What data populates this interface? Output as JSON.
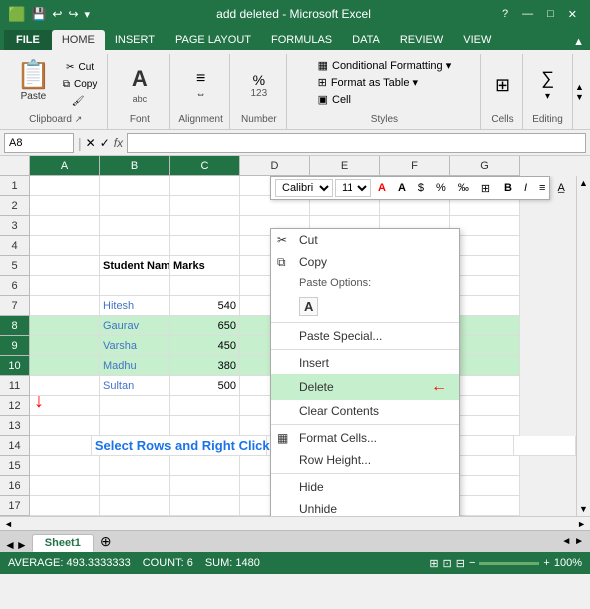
{
  "titleBar": {
    "title": "add deleted - Microsoft Excel",
    "controls": [
      "?",
      "—",
      "□",
      "✕"
    ]
  },
  "ribbonTabs": [
    "FILE",
    "HOME",
    "INSERT",
    "PAGE LAYOUT",
    "FORMULAS",
    "DATA",
    "REVIEW",
    "VIEW"
  ],
  "activeTab": "HOME",
  "ribbon": {
    "clipboard": {
      "label": "Clipboard",
      "paste": "Paste"
    },
    "font": {
      "label": "Font"
    },
    "alignment": {
      "label": "Alignment"
    },
    "number": {
      "label": "Number"
    },
    "conditionalFormatting": "Conditional Formatting ▾",
    "formatAsTable": "Format as Table ▾",
    "cellStyle": "Cell",
    "cells": {
      "label": "Cells"
    },
    "editing": {
      "label": "Editing"
    }
  },
  "formulaBar": {
    "nameBox": "A8",
    "fx": "fx"
  },
  "columns": [
    "A",
    "B",
    "C",
    "D",
    "E",
    "F",
    "G"
  ],
  "rows": [
    {
      "num": 1,
      "cells": [
        "",
        "",
        "",
        "",
        "",
        "",
        ""
      ]
    },
    {
      "num": 2,
      "cells": [
        "",
        "",
        "",
        "",
        "",
        "",
        ""
      ]
    },
    {
      "num": 3,
      "cells": [
        "",
        "",
        "",
        "",
        "",
        "",
        ""
      ]
    },
    {
      "num": 4,
      "cells": [
        "",
        "",
        "",
        "",
        "",
        "",
        ""
      ]
    },
    {
      "num": 5,
      "cells": [
        "",
        "Student Name",
        "Marks",
        "",
        "",
        "",
        ""
      ]
    },
    {
      "num": 6,
      "cells": [
        "",
        "",
        "",
        "",
        "",
        "",
        ""
      ]
    },
    {
      "num": 7,
      "cells": [
        "",
        "Hitesh",
        "540",
        "",
        "",
        "",
        ""
      ]
    },
    {
      "num": 8,
      "cells": [
        "",
        "Gaurav",
        "650",
        "",
        "",
        "",
        ""
      ],
      "selected": true
    },
    {
      "num": 9,
      "cells": [
        "",
        "Varsha",
        "450",
        "",
        "",
        "",
        ""
      ],
      "selected": true
    },
    {
      "num": 10,
      "cells": [
        "",
        "Madhu",
        "380",
        "",
        "",
        "",
        ""
      ],
      "selected": true
    },
    {
      "num": 11,
      "cells": [
        "",
        "Sultan",
        "500",
        "",
        "",
        "",
        ""
      ]
    },
    {
      "num": 12,
      "cells": [
        "",
        "",
        "",
        "",
        "",
        "",
        ""
      ]
    },
    {
      "num": 13,
      "cells": [
        "",
        "",
        "",
        "",
        "",
        "",
        ""
      ]
    },
    {
      "num": 14,
      "cells": [
        "",
        "",
        "",
        "",
        "",
        "",
        ""
      ]
    },
    {
      "num": 15,
      "cells": [
        "",
        "",
        "",
        "",
        "",
        "",
        ""
      ]
    },
    {
      "num": 16,
      "cells": [
        "",
        "",
        "",
        "",
        "",
        "",
        ""
      ]
    },
    {
      "num": 17,
      "cells": [
        "",
        "",
        "",
        "",
        "",
        "",
        ""
      ]
    }
  ],
  "contextMenu": {
    "items": [
      {
        "label": "Cut",
        "icon": "✂",
        "id": "cut"
      },
      {
        "label": "Copy",
        "icon": "⧉",
        "id": "copy"
      },
      {
        "label": "Paste Options:",
        "icon": "",
        "id": "paste-options",
        "isHeader": true
      },
      {
        "label": "A",
        "icon": "",
        "id": "paste-a",
        "isPasteIcon": true
      },
      {
        "label": "Paste Special...",
        "icon": "",
        "id": "paste-special"
      },
      {
        "label": "Insert",
        "icon": "",
        "id": "insert"
      },
      {
        "label": "Delete",
        "icon": "",
        "id": "delete",
        "highlighted": true
      },
      {
        "label": "Clear Contents",
        "icon": "",
        "id": "clear-contents"
      },
      {
        "label": "Format Cells...",
        "icon": "▦",
        "id": "format-cells"
      },
      {
        "label": "Row Height...",
        "icon": "",
        "id": "row-height"
      },
      {
        "label": "Hide",
        "icon": "",
        "id": "hide"
      },
      {
        "label": "Unhide",
        "icon": "",
        "id": "unhide"
      }
    ]
  },
  "miniToolbar": {
    "font": "Calibri",
    "size": "11",
    "items": [
      "B",
      "I",
      "≡",
      "A",
      "A",
      "$",
      "%",
      "‰",
      "⊞"
    ]
  },
  "annotation": {
    "text": "Select Rows and Right Click",
    "arrowRight": "→",
    "arrowDown": "↓"
  },
  "sheetTabs": [
    "Sheet1"
  ],
  "statusBar": {
    "average": "AVERAGE: 493.3333333",
    "count": "COUNT: 6",
    "sum": "SUM: 1480",
    "zoom": "100%"
  }
}
